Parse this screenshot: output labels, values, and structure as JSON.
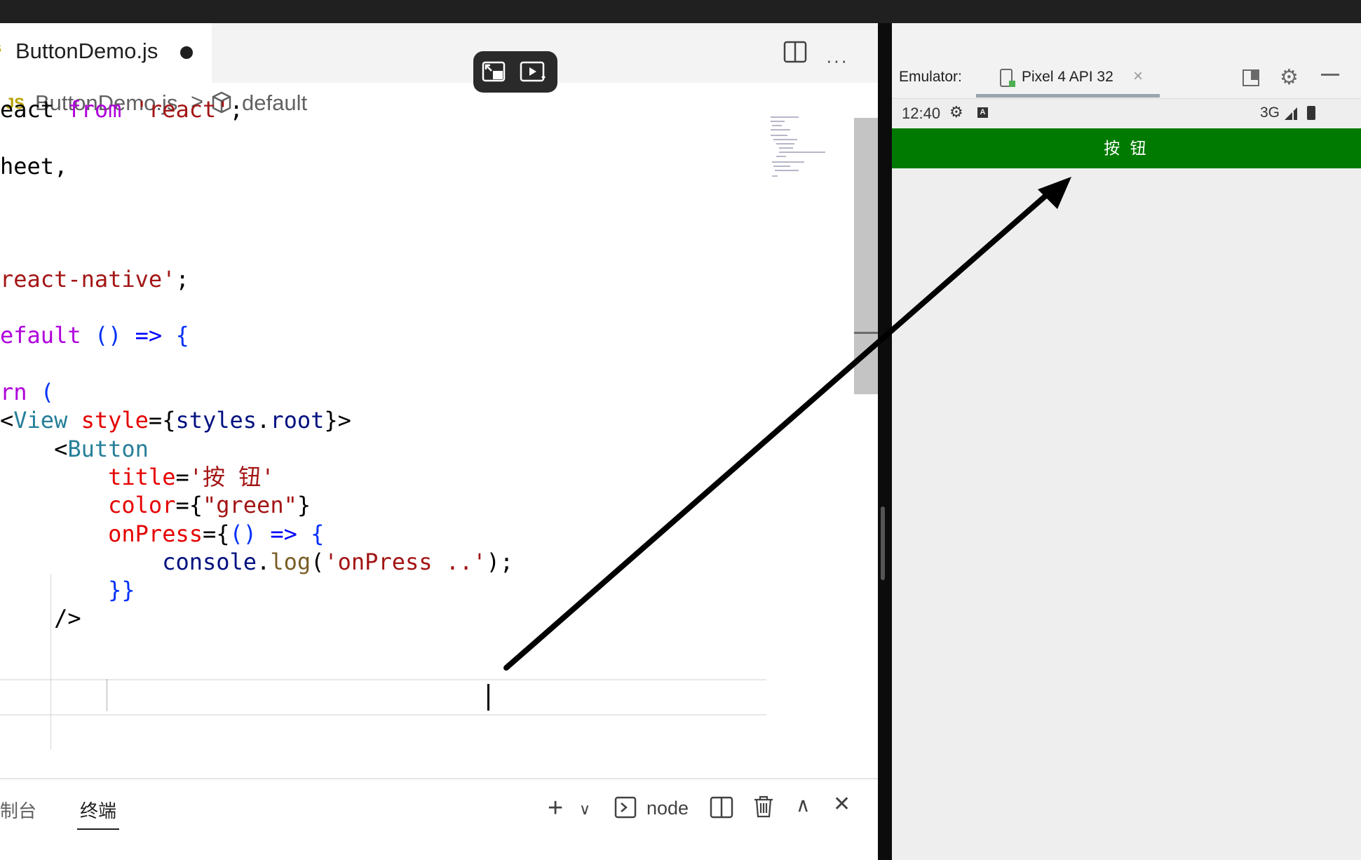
{
  "editor": {
    "tab": {
      "filename": "ButtonDemo.js",
      "js_mark": "JS"
    },
    "breadcrumb": {
      "file": "ButtonDemo.js",
      "separator": ">",
      "symbol": "default"
    },
    "more_actions": "···",
    "code_lines": [
      {
        "id": "l1",
        "tokens": [
          [
            "plain",
            "eact "
          ],
          [
            "kw",
            "from "
          ],
          [
            "str",
            "'react'"
          ],
          [
            "plain",
            ";"
          ]
        ]
      },
      {
        "id": "l2",
        "tokens": [
          [
            "plain",
            "heet,"
          ]
        ]
      },
      {
        "id": "l3",
        "tokens": [
          [
            "str",
            "react-native'"
          ],
          [
            "plain",
            ";"
          ]
        ]
      },
      {
        "id": "l4",
        "tokens": [
          [
            "kw",
            "efault "
          ],
          [
            "brk",
            "() "
          ],
          [
            "punct",
            "=> "
          ],
          [
            "brk",
            "{"
          ]
        ]
      },
      {
        "id": "l5",
        "tokens": [
          [
            "kw",
            "rn "
          ],
          [
            "brk",
            "("
          ]
        ]
      },
      {
        "id": "l6",
        "tokens": [
          [
            "plain",
            "<"
          ],
          [
            "tag",
            "View "
          ],
          [
            "attr",
            "style"
          ],
          [
            "plain",
            "={"
          ],
          [
            "var",
            "styles"
          ],
          [
            "plain",
            "."
          ],
          [
            "var",
            "root"
          ],
          [
            "plain",
            "}>"
          ]
        ]
      },
      {
        "id": "l7",
        "tokens": [
          [
            "plain",
            "    <"
          ],
          [
            "tag",
            "Button"
          ]
        ]
      },
      {
        "id": "l8",
        "tokens": [
          [
            "plain",
            "        "
          ],
          [
            "attr",
            "title"
          ],
          [
            "plain",
            "="
          ],
          [
            "str",
            "'按 钮'"
          ]
        ]
      },
      {
        "id": "l9",
        "tokens": [
          [
            "plain",
            "        "
          ],
          [
            "attr",
            "color"
          ],
          [
            "plain",
            "={"
          ],
          [
            "str",
            "\"green\""
          ],
          [
            "plain",
            "}"
          ]
        ]
      },
      {
        "id": "l10",
        "tokens": [
          [
            "plain",
            "        "
          ],
          [
            "attr",
            "onPress"
          ],
          [
            "plain",
            "={"
          ],
          [
            "brk",
            "() "
          ],
          [
            "punct",
            "=> "
          ],
          [
            "brk",
            "{"
          ]
        ]
      },
      {
        "id": "l11",
        "tokens": [
          [
            "plain",
            "            "
          ],
          [
            "var",
            "console"
          ],
          [
            "plain",
            "."
          ],
          [
            "fn",
            "log"
          ],
          [
            "plain",
            "("
          ],
          [
            "str",
            "'onPress ..'"
          ],
          [
            "plain",
            ");"
          ]
        ]
      },
      {
        "id": "l12",
        "tokens": [
          [
            "plain",
            "        "
          ],
          [
            "brk",
            "}}"
          ]
        ]
      },
      {
        "id": "l13",
        "tokens": [
          [
            "plain",
            "    />"
          ]
        ]
      }
    ]
  },
  "panel": {
    "tab_console": "控制台",
    "tab_terminal": "终端",
    "terminal_name": "node",
    "new_terminal": "+",
    "menu": "∨",
    "maximize": "∧",
    "close": "✕"
  },
  "emulator": {
    "label": "Emulator:",
    "device": "Pixel 4 API 32",
    "tab_close": "×",
    "settings": "⚙",
    "status": {
      "time": "12:40",
      "network": "3G",
      "settings": "⚙",
      "a": "A"
    },
    "app_button": {
      "title": "按 钮",
      "color": "#007a00"
    }
  },
  "colors": {
    "keyword": "#af00db",
    "string": "#a31515",
    "jsx_tag": "#267f99",
    "jsx_attr": "#e50000",
    "variable": "#001080"
  }
}
